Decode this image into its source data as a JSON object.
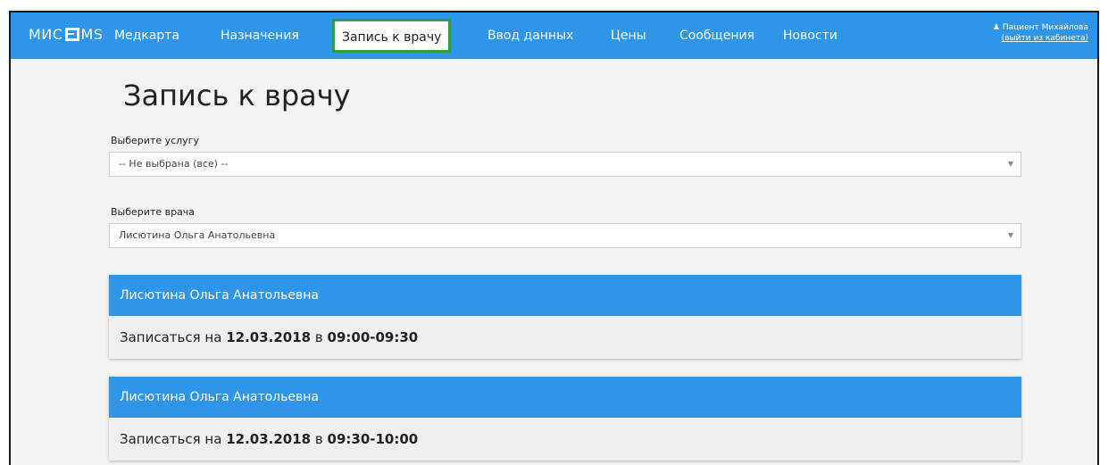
{
  "brand": {
    "text_left": "МИС",
    "text_right": "MS"
  },
  "nav": {
    "items": [
      {
        "label": "Медкарта"
      },
      {
        "label": "Назначения"
      },
      {
        "label": "Запись к врачу",
        "active": true
      },
      {
        "label": "Ввод данных"
      },
      {
        "label": "Цены"
      },
      {
        "label": "Сообщения"
      },
      {
        "label": "Новости"
      }
    ]
  },
  "user": {
    "name": "Пациент Михайлова",
    "logout": "(выйти из кабинета)"
  },
  "page": {
    "title": "Запись к врачу",
    "service": {
      "label": "Выберите услугу",
      "value": "-- Не выбрана (все) --"
    },
    "doctor": {
      "label": "Выберите врача",
      "value": "Лисютина Ольга Анатольевна"
    }
  },
  "slots": [
    {
      "doctor": "Лисютина Ольга Анатольевна",
      "prefix": "Записаться на",
      "date": "12.03.2018",
      "sep": "в",
      "time": "09:00-09:30"
    },
    {
      "doctor": "Лисютина Ольга Анатольевна",
      "prefix": "Записаться на",
      "date": "12.03.2018",
      "sep": "в",
      "time": "09:30-10:00"
    }
  ],
  "colors": {
    "navbar": "#2e95e8",
    "active_border": "#2f9e44",
    "background": "#f3f3f3"
  }
}
